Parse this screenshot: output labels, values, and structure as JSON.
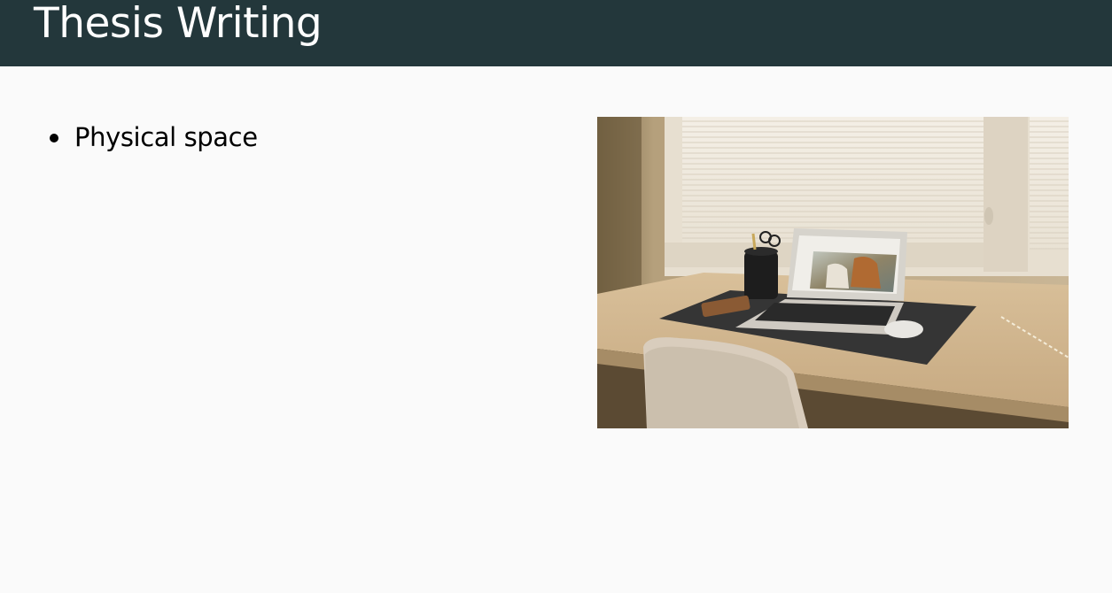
{
  "slide": {
    "title": "Thesis Writing",
    "colors": {
      "header_background": "#23373b",
      "header_text": "#ffffff",
      "page_background": "#fafafa",
      "body_text": "#000000"
    }
  },
  "content": {
    "bullets": [
      {
        "label": "Physical space"
      }
    ]
  },
  "image": {
    "subject": "photo of a laptop on a wooden desk in front of a window"
  }
}
